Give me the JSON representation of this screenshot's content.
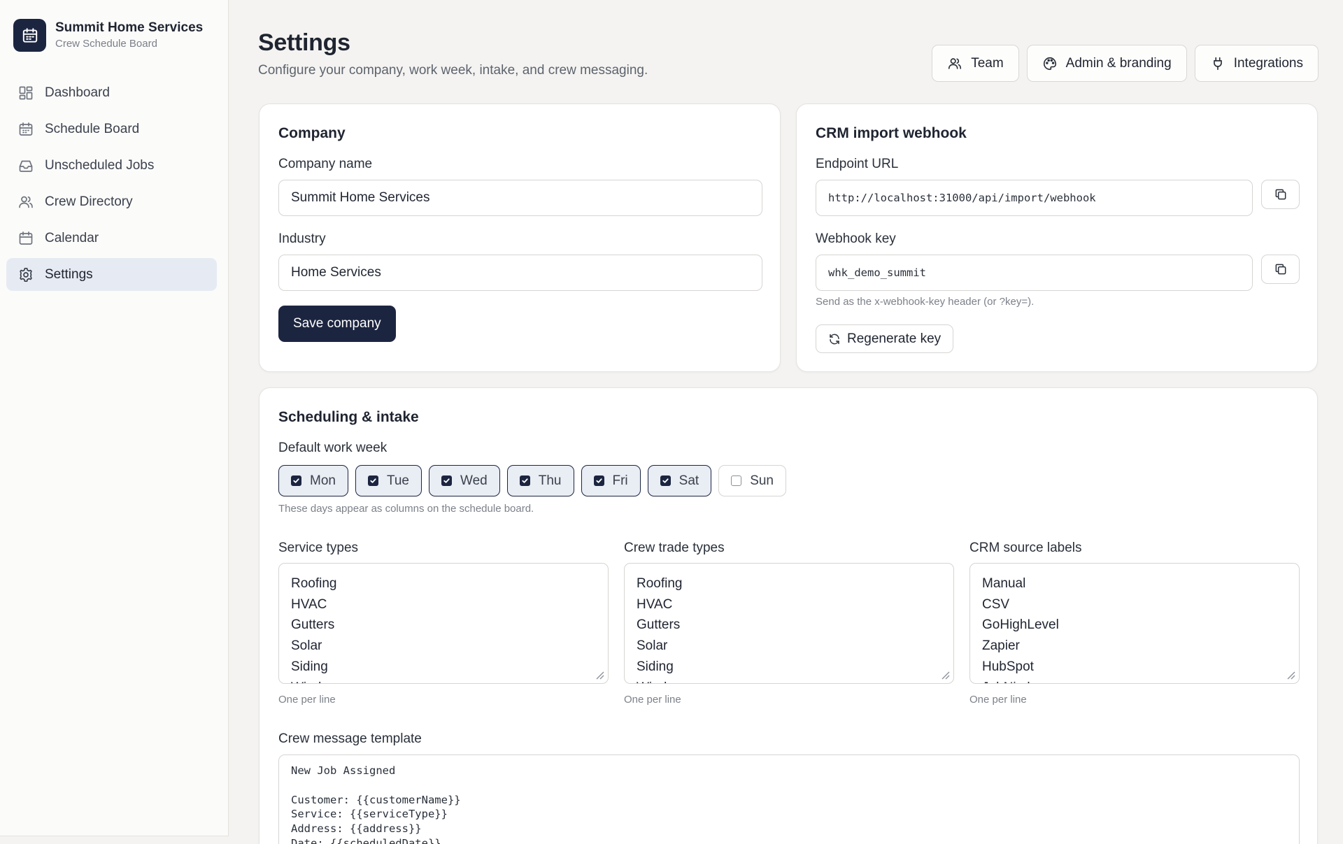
{
  "app": {
    "name": "Summit Home Services",
    "subtitle": "Crew Schedule Board"
  },
  "sidebar": {
    "items": [
      {
        "label": "Dashboard",
        "icon": "dashboard-icon"
      },
      {
        "label": "Schedule Board",
        "icon": "calendar-grid-icon"
      },
      {
        "label": "Unscheduled Jobs",
        "icon": "inbox-icon"
      },
      {
        "label": "Crew Directory",
        "icon": "users-icon"
      },
      {
        "label": "Calendar",
        "icon": "calendar-icon"
      },
      {
        "label": "Settings",
        "icon": "gear-icon",
        "active": true
      }
    ]
  },
  "header": {
    "title": "Settings",
    "subtitle": "Configure your company, work week, intake, and crew messaging.",
    "actions": [
      {
        "label": "Team",
        "icon": "users-icon"
      },
      {
        "label": "Admin & branding",
        "icon": "palette-icon"
      },
      {
        "label": "Integrations",
        "icon": "plug-icon"
      }
    ]
  },
  "company": {
    "title": "Company",
    "name_label": "Company name",
    "name_value": "Summit Home Services",
    "industry_label": "Industry",
    "industry_value": "Home Services",
    "save_label": "Save company"
  },
  "webhook": {
    "title": "CRM import webhook",
    "endpoint_label": "Endpoint URL",
    "endpoint_value": "http://localhost:31000/api/import/webhook",
    "key_label": "Webhook key",
    "key_value": "whk_demo_summit",
    "key_hint": "Send as the x-webhook-key header (or ?key=).",
    "regenerate_label": "Regenerate key"
  },
  "scheduling": {
    "title": "Scheduling & intake",
    "work_week_label": "Default work week",
    "days": [
      {
        "label": "Mon",
        "checked": true
      },
      {
        "label": "Tue",
        "checked": true
      },
      {
        "label": "Wed",
        "checked": true
      },
      {
        "label": "Thu",
        "checked": true
      },
      {
        "label": "Fri",
        "checked": true
      },
      {
        "label": "Sat",
        "checked": true
      },
      {
        "label": "Sun",
        "checked": false
      }
    ],
    "days_hint": "These days appear as columns on the schedule board.",
    "service_types": {
      "label": "Service types",
      "lines": [
        "Roofing",
        "HVAC",
        "Gutters",
        "Solar",
        "Siding",
        "Windows"
      ],
      "hint": "One per line"
    },
    "crew_trade_types": {
      "label": "Crew trade types",
      "lines": [
        "Roofing",
        "HVAC",
        "Gutters",
        "Solar",
        "Siding",
        "Windows"
      ],
      "hint": "One per line"
    },
    "crm_source_labels": {
      "label": "CRM source labels",
      "lines": [
        "Manual",
        "CSV",
        "GoHighLevel",
        "Zapier",
        "HubSpot",
        "JobNimbus"
      ],
      "hint": "One per line"
    },
    "template_label": "Crew message template",
    "template_lines": [
      "New Job Assigned",
      "",
      "Customer: {{customerName}}",
      "Service: {{serviceType}}",
      "Address: {{address}}",
      "Date: {{scheduledDate}}"
    ]
  },
  "colors": {
    "primary": "#1c2540",
    "active_nav_bg": "#e6ebf3",
    "page_bg": "#f4f3f1"
  }
}
